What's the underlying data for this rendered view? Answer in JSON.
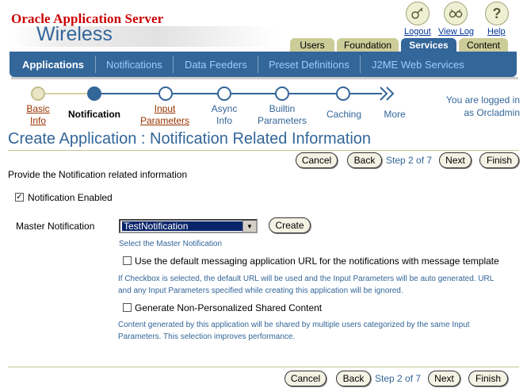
{
  "branding": {
    "line1": "Oracle Application Server",
    "line2": "Wireless"
  },
  "global_links": [
    {
      "label": "Logout",
      "icon": "logout-icon"
    },
    {
      "label": "View Log",
      "icon": "view-log-icon"
    },
    {
      "label": "Help",
      "icon": "help-icon"
    }
  ],
  "tabs": [
    {
      "label": "Users"
    },
    {
      "label": "Foundation"
    },
    {
      "label": "Services",
      "active": true
    },
    {
      "label": "Content"
    }
  ],
  "subnav": [
    {
      "label": "Applications",
      "active": true
    },
    {
      "label": "Notifications"
    },
    {
      "label": "Data Feeders"
    },
    {
      "label": "Preset Definitions"
    },
    {
      "label": "J2ME Web Services"
    }
  ],
  "train": {
    "steps": [
      {
        "line1": "Basic",
        "line2": "Info"
      },
      {
        "line1": "Notification",
        "line2": ""
      },
      {
        "line1": "Input",
        "line2": "Parameters"
      },
      {
        "line1": "Async",
        "line2": "Info"
      },
      {
        "line1": "Builtin",
        "line2": "Parameters"
      },
      {
        "line1": "Caching",
        "line2": ""
      }
    ],
    "more": "More"
  },
  "login": {
    "line1": "You are logged in",
    "line2": "as Orcladmin"
  },
  "page_title": "Create Application : Notification Related Information",
  "nav_buttons": {
    "cancel": "Cancel",
    "back": "Back",
    "step": "Step 2 of 7",
    "next": "Next",
    "finish": "Finish"
  },
  "instruction": "Provide the Notification related information",
  "notification_enabled": {
    "label": "Notification Enabled",
    "checked": true
  },
  "master_notification": {
    "label": "Master Notification",
    "value": "TestNotification",
    "create_button": "Create",
    "help": "Select the Master Notification"
  },
  "default_url": {
    "label": "Use the default messaging application URL for the notifications with message template",
    "checked": false,
    "help1": "If Checkbox is selected, the default URL will be used and the Input Parameters will be auto generated. URL",
    "help2": "and any Input Parameters specified while creating this application will be ignored."
  },
  "shared_content": {
    "label": "Generate Non-Personalized Shared Content",
    "checked": false,
    "help1": "Content generated by this application will be shared by multiple users categorized by the same Input",
    "help2": "Parameters. This selection improves performance."
  },
  "colors": {
    "brand_red": "#cc0000",
    "oracle_blue": "#336699",
    "tab_khaki": "#cccc99"
  }
}
